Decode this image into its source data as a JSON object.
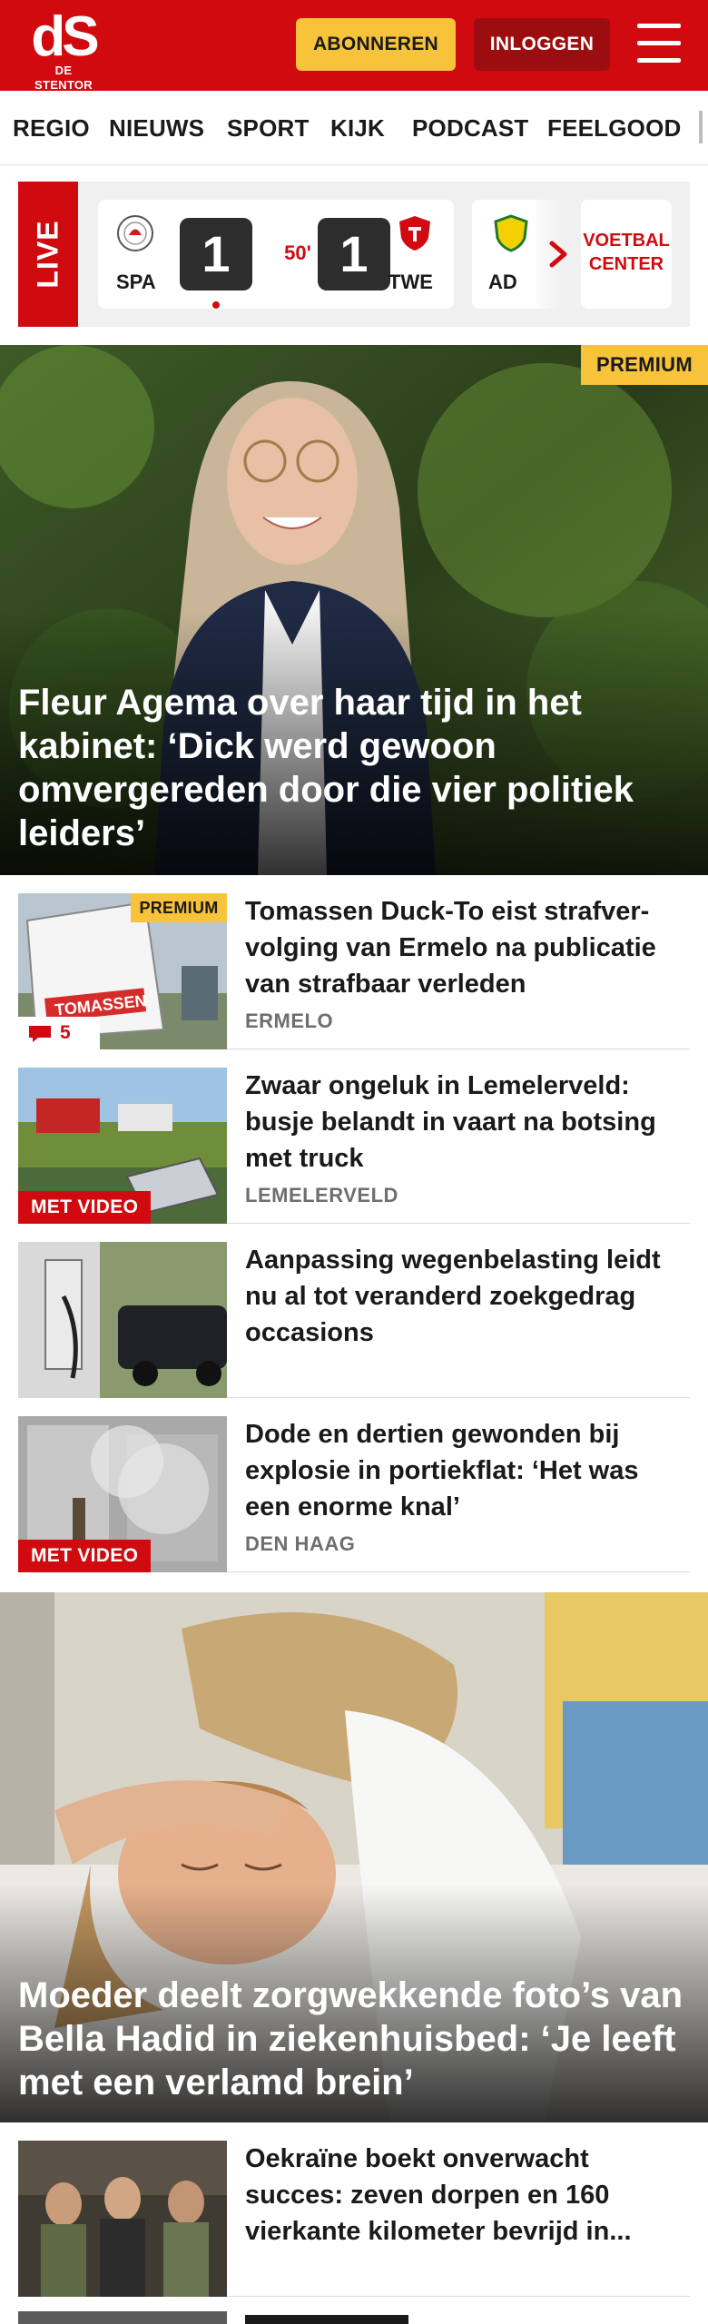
{
  "header": {
    "logo_mark": "dS",
    "logo_name": "DE STENTOR",
    "subscribe_label": "ABONNEREN",
    "login_label": "INLOGGEN",
    "brand_color": "#d10a10",
    "accent_color": "#f6c33b"
  },
  "nav": {
    "items": [
      "REGIO",
      "NIEUWS",
      "SPORT",
      "KIJK",
      "PODCAST",
      "FEELGOOD"
    ]
  },
  "live": {
    "label": "LIVE",
    "match": {
      "home": "SPA",
      "away": "TWE",
      "home_score": "1",
      "away_score": "1",
      "minute": "50'"
    },
    "next_team": "AD",
    "center_label_1": "VOETBAL",
    "center_label_2": "CENTER"
  },
  "hero": {
    "badge": "PREMIUM",
    "title_lines": [
      "Fleur Agema over haar tijd in het",
      "kabinet: ‘Dick werd gewoon",
      "omvergereden door die vier politiek",
      "leiders’"
    ]
  },
  "articles": [
    {
      "title_lines": [
        "Tomassen Duck-To eist strafver-",
        "volging van Ermelo na publicatie",
        "van strafbaar verleden"
      ],
      "location": "ERMELO",
      "premium": "PREMIUM",
      "comments": "5"
    },
    {
      "title_lines": [
        "Zwaar ongeluk in Lemelerveld:",
        "busje belandt in vaart na botsing",
        "met truck"
      ],
      "location": "LEMELERVELD",
      "video": "MET VIDEO"
    },
    {
      "title_lines": [
        "Aanpassing wegenbelasting leidt",
        "nu al tot veranderd zoekgedrag",
        "occasions"
      ]
    },
    {
      "title_lines": [
        "Dode en dertien gewonden bij",
        "explosie in portiekflat: ‘Het was",
        "een enorme knal’"
      ],
      "location": "DEN HAAG",
      "video": "MET VIDEO"
    },
    {
      "title_lines": [
        "Oekraïne boekt onverwacht",
        "succes: zeven dorpen en 160",
        "vierkante kilometer bevrijd in..."
      ]
    }
  ],
  "hero2": {
    "title_lines": [
      "Moeder deelt zorgwekkende foto’s van",
      "Bella Hadid in ziekenhuisbed: ‘Je leeft",
      "met een verlamd brein’"
    ]
  }
}
